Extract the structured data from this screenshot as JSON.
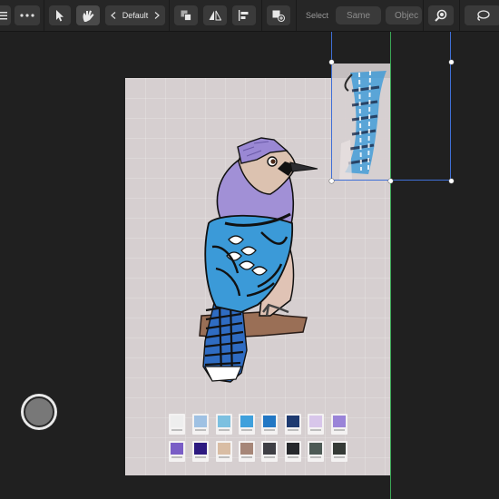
{
  "toolbar": {
    "preset_label": "Default",
    "select_label": "Select",
    "same_label": "Same",
    "object_label": "Objec"
  },
  "icons": [
    "menu-icon",
    "more-icon",
    "move-tool-icon",
    "node-tool-icon",
    "chevron-left-icon",
    "chevron-right-icon",
    "arrange-icon",
    "flip-icon",
    "align-icon",
    "add-layer-icon",
    "zoom-icon",
    "lasso-icon"
  ],
  "colors": {
    "accent_blue": "#3f6fd6",
    "guide_green": "#3aa655",
    "artboard_bg": "#d6cfd0"
  },
  "palette": {
    "row1": [
      "#eeeeee",
      "#9fc1e3",
      "#7cc0e0",
      "#3fa0dc",
      "#2277c4",
      "#1e3a70",
      "#d8c6ea",
      "#9a84d8"
    ],
    "row2": [
      "#7a5ec6",
      "#2d1a80",
      "#d9bda4",
      "#a68678",
      "#3e3e44",
      "#26282c",
      "#4d5a55",
      "#353a36"
    ]
  }
}
